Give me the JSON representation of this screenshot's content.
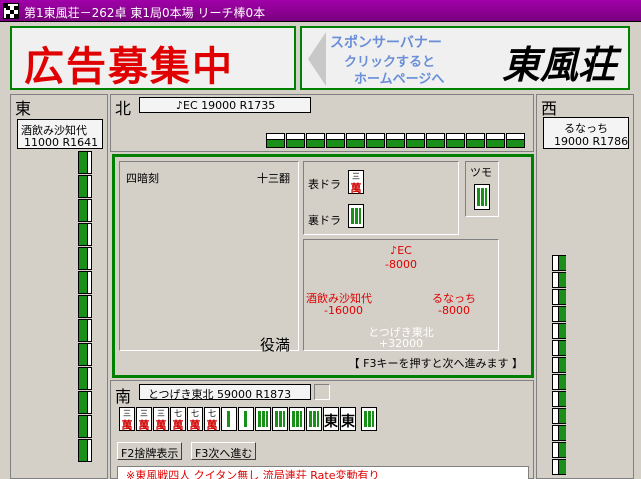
{
  "window": {
    "title": "第1東風荘－262卓 東1局0本場 リーチ棒0本"
  },
  "banners": {
    "left_text": "広告募集中",
    "right_line1": "スポンサーバナー",
    "right_line2": "クリックすると",
    "right_line3": "ホームページへ",
    "right_logo": "東風荘"
  },
  "seats": {
    "north": {
      "label": "北",
      "player": "♪EC  19000 R1735"
    },
    "east": {
      "label": "東",
      "name": "酒飲み沙知代",
      "score": "11000 R1641"
    },
    "west": {
      "label": "西",
      "name": "るなっち",
      "score": "19000 R1786"
    },
    "south": {
      "label": "南",
      "player": "とつげき東北  59000 R1873"
    }
  },
  "result": {
    "yaku": "四暗刻",
    "han": "十三翻",
    "limit": "役満",
    "dora_label": "表ドラ",
    "ura_label": "裏ドラ",
    "tsumo_label": "ツモ",
    "dora_tile": {
      "num": "三",
      "suit": "萬"
    },
    "payments": {
      "north_name": "♪EC",
      "north_delta": "-8000",
      "east_name": "酒飲み沙知代",
      "east_delta": "-16000",
      "west_name": "るなっち",
      "west_delta": "-8000",
      "south_name": "とつげき東北",
      "south_delta": "+32000"
    },
    "hint": "【 F3キーを押すと次へ進みます 】"
  },
  "hand": {
    "man_tiles": [
      {
        "num": "三",
        "suit": "萬"
      },
      {
        "num": "三",
        "suit": "萬"
      },
      {
        "num": "三",
        "suit": "萬"
      },
      {
        "num": "七",
        "suit": "萬"
      },
      {
        "num": "七",
        "suit": "萬"
      },
      {
        "num": "七",
        "suit": "萬"
      }
    ],
    "honor_tiles": [
      "東",
      "東"
    ]
  },
  "buttons": {
    "f2": "F2捨牌表示",
    "f3": "F3次へ進む"
  },
  "footer": {
    "rules": "※東風戦四人 クイタン無し 流局連荘 Rate変動有り"
  },
  "colors": {
    "title_bar": "#8a008e",
    "panel_border": "#008000",
    "tile_back": "#1a8f1a",
    "red_text": "#e00000"
  }
}
